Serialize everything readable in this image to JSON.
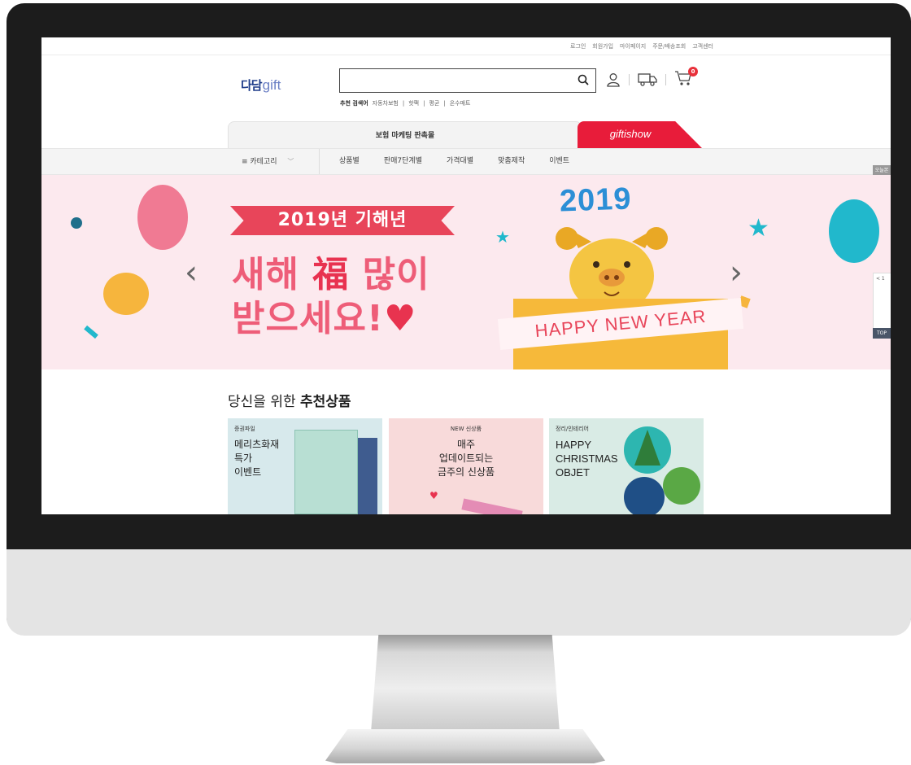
{
  "util_links": [
    "로그인",
    "회원가입",
    "마이페이지",
    "주문/배송조회",
    "고객센터"
  ],
  "logo": {
    "ko": "다담",
    "en": "gift"
  },
  "search": {
    "value": "",
    "keywords_label": "추천 검색어",
    "keywords": [
      "자동차보험",
      "핫팩",
      "평균",
      "온수매트"
    ]
  },
  "cart_count": "0",
  "mall_tabs": {
    "marketing": "보험 마케팅 판촉몰",
    "giftishow": "giftishow"
  },
  "gnb": {
    "category": "≡ 카테고리",
    "menu": [
      "상품별",
      "판매7단계별",
      "가격대별",
      "맞춤제작",
      "이벤트"
    ]
  },
  "today_tab": "오늘본",
  "side_widget": {
    "page": "< 1",
    "top": "TOP"
  },
  "banner": {
    "ribbon": "2019년 기해년",
    "line1_a": "새해",
    "line1_b": "福",
    "line1_c": "많이",
    "line2": "받으세요!",
    "heart": "♥",
    "year": "2019",
    "box_text": "HAPPY NEW YEAR"
  },
  "recommend": {
    "title_plain": "당신을 위한",
    "title_bold": "추천상품",
    "cards": [
      {
        "category": "증권파일",
        "text": "메리츠화재\n특가\n이벤트"
      },
      {
        "category": "NEW 신상품",
        "text": "매주\n업데이트되는\n금주의 신상품"
      },
      {
        "category": "정리/인테리어",
        "text": "HAPPY\nCHRISTMAS\nOBJET"
      }
    ]
  },
  "colors": {
    "banner_bg": "#fce9ee",
    "headline": "#ee5d78",
    "giftishow": "#e81c3a",
    "logo": "#1f3d8a"
  }
}
